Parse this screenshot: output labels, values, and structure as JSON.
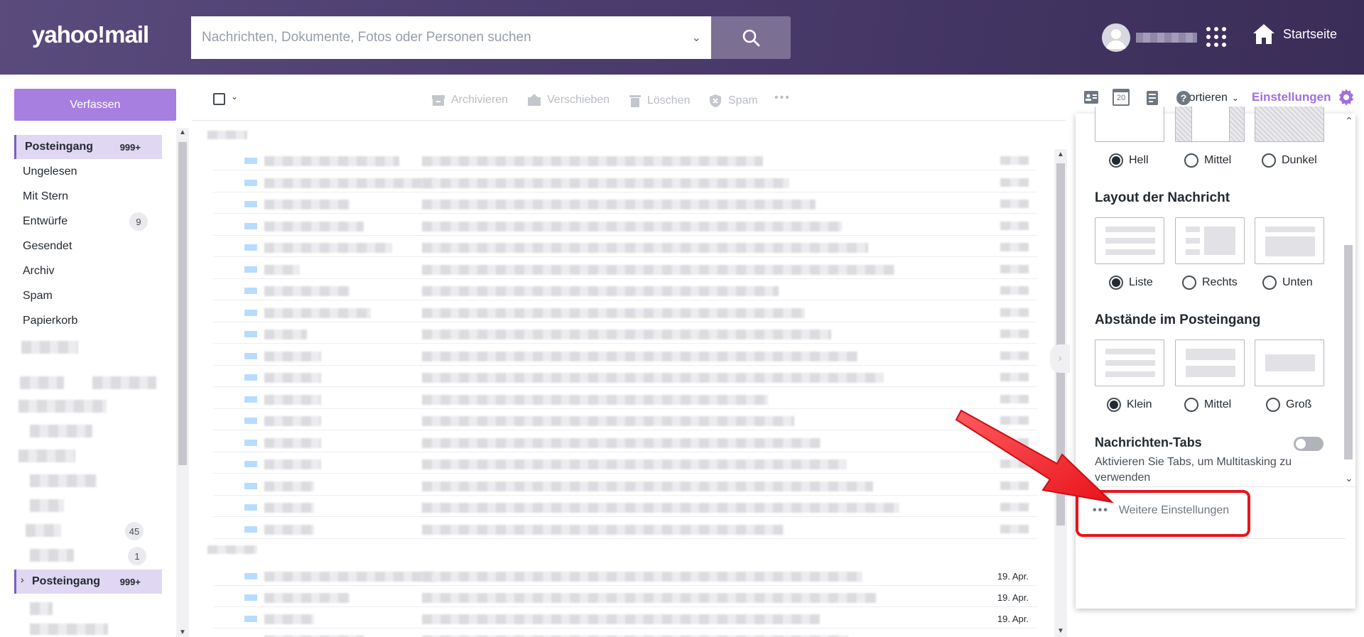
{
  "header": {
    "logo": "yahoo!mail",
    "search_placeholder": "Nachrichten, Dokumente, Fotos oder Personen suchen",
    "home_label": "Startseite"
  },
  "sidebar": {
    "compose_label": "Verfassen",
    "folders": [
      {
        "label": "Posteingang",
        "count": "999+"
      },
      {
        "label": "Ungelesen"
      },
      {
        "label": "Mit Stern"
      },
      {
        "label": "Entwürfe",
        "badge": "9"
      },
      {
        "label": "Gesendet"
      },
      {
        "label": "Archiv"
      },
      {
        "label": "Spam"
      },
      {
        "label": "Papierkorb"
      }
    ],
    "extra_badges": [
      "45",
      "1"
    ],
    "bottom_folder": {
      "label": "Posteingang",
      "count": "999+"
    }
  },
  "toolbar": {
    "archive": "Archivieren",
    "move": "Verschieben",
    "delete": "Löschen",
    "spam": "Spam",
    "more": "•••",
    "sort": "Sortieren"
  },
  "list": {
    "dates": [
      "19. Apr.",
      "19. Apr.",
      "19. Apr."
    ]
  },
  "right_toolbar": {
    "calendar_day": "20",
    "settings_label": "Einstellungen"
  },
  "settings": {
    "theme_options": [
      {
        "label": "Hell",
        "selected": true
      },
      {
        "label": "Mittel",
        "selected": false
      },
      {
        "label": "Dunkel",
        "selected": false
      }
    ],
    "layout_title": "Layout der Nachricht",
    "layout_options": [
      {
        "label": "Liste",
        "selected": true
      },
      {
        "label": "Rechts",
        "selected": false
      },
      {
        "label": "Unten",
        "selected": false
      }
    ],
    "spacing_title": "Abstände im Posteingang",
    "spacing_options": [
      {
        "label": "Klein",
        "selected": true
      },
      {
        "label": "Mittel",
        "selected": false
      },
      {
        "label": "Groß",
        "selected": false
      }
    ],
    "tabs_title": "Nachrichten-Tabs",
    "tabs_description": "Aktivieren Sie Tabs, um Multitasking zu verwenden",
    "tabs_enabled": false,
    "more_settings": "Weitere Einstellungen"
  },
  "colors": {
    "header": "#4c3d6f",
    "accent": "#a77fe0",
    "settings_accent": "#9d6fe0",
    "annotation": "#e8141b"
  }
}
